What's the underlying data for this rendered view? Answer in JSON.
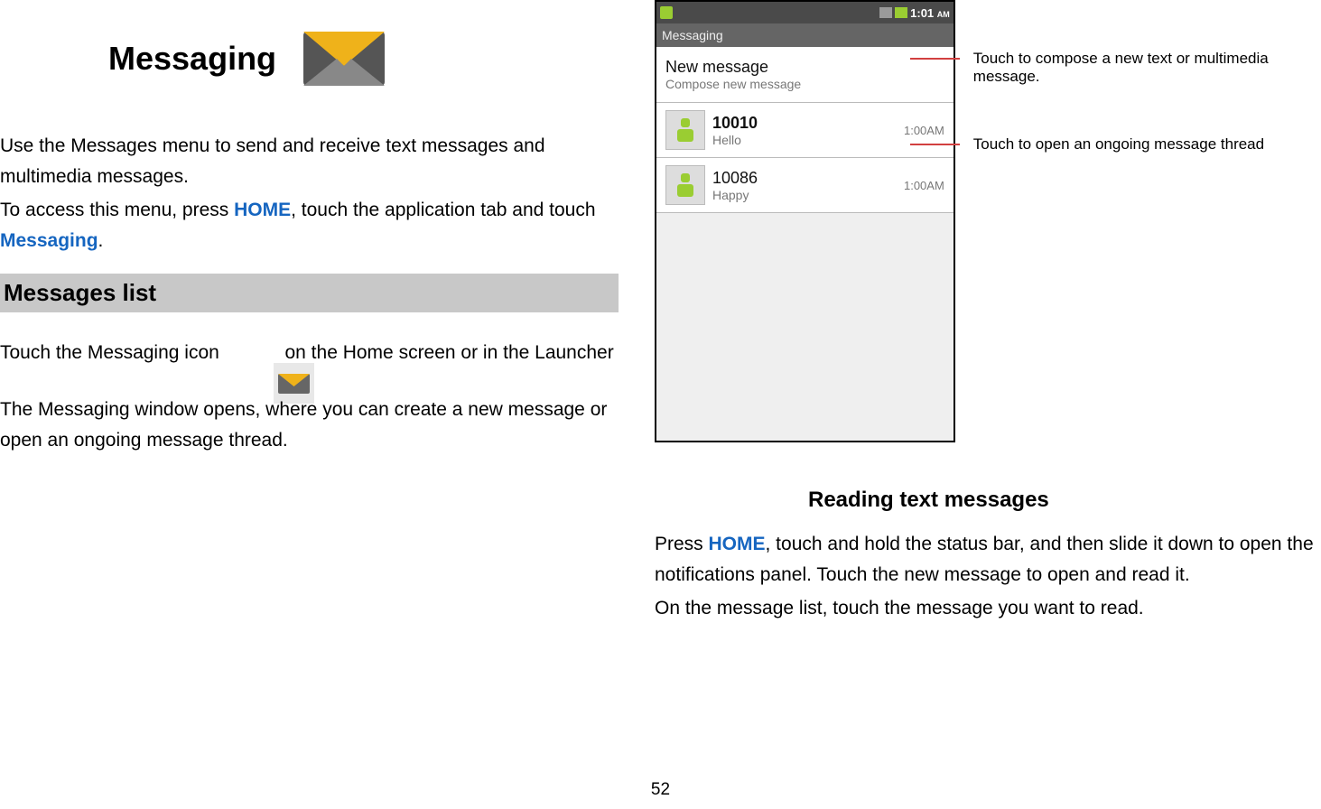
{
  "left": {
    "title": "Messaging",
    "intro1": "Use the Messages menu to send and receive text messages and multimedia messages.",
    "intro2a": "To access this menu, press ",
    "home": "HOME",
    "intro2b": ", touch the application tab and touch ",
    "messaging_link": "Messaging",
    "intro2c": ".",
    "section_header": "Messages list",
    "line1a": "Touch the Messaging icon ",
    "line1b": " on the Home screen or in the Launcher",
    "line2": "The Messaging window opens, where you can create a new message or open an ongoing message thread."
  },
  "phone": {
    "clock": "1:01",
    "ampm": "AM",
    "title": "Messaging",
    "new_msg_title": "New message",
    "new_msg_sub": "Compose new message",
    "thread1_title": "10010",
    "thread1_sub": "Hello",
    "thread1_time": "1:00AM",
    "thread2_title": "10086",
    "thread2_sub": "Happy",
    "thread2_time": "1:00AM"
  },
  "callouts": {
    "c1": "Touch to compose a new text or multimedia message.",
    "c2": "Touch to open an ongoing message thread"
  },
  "right": {
    "subheading": "Reading text messages",
    "p1a": "Press ",
    "home": "HOME",
    "p1b": ", touch and hold the status bar, and then slide it down to open the notifications panel. Touch the new message to open and read it.",
    "p2": "On the message list, touch the message you want to read."
  },
  "page_number": "52"
}
